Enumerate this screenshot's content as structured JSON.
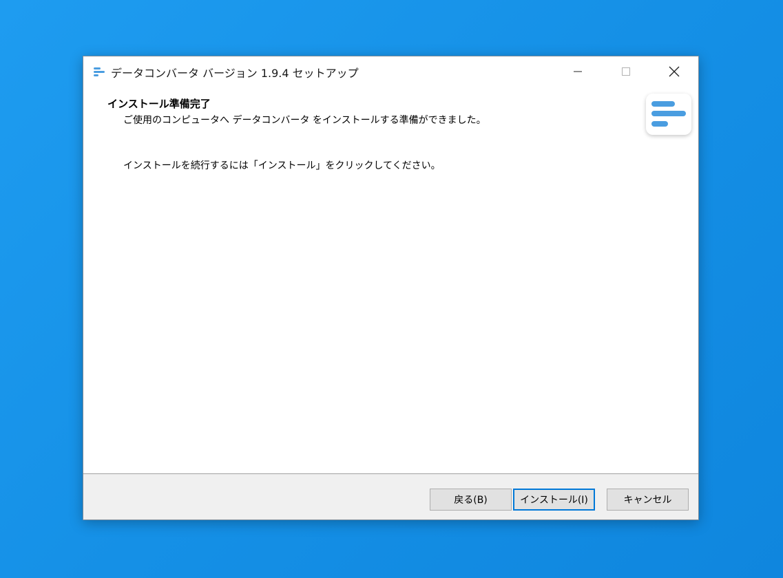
{
  "window": {
    "title": "データコンバータ バージョン 1.9.4 セットアップ"
  },
  "page": {
    "heading": "インストール準備完了",
    "subheading": "ご使用のコンピュータへ データコンバータ をインストールする準備ができました。",
    "instruction": "インストールを続行するには「インストール」をクリックしてください。"
  },
  "buttons": {
    "back": "戻る(B)",
    "install": "インストール(I)",
    "cancel": "キャンセル"
  },
  "colors": {
    "accent": "#0078d7",
    "logo_bars": "#4a9de0",
    "desktop": "#1a96e8"
  },
  "icons": {
    "app": "app-logo-icon",
    "minimize": "minimize-icon",
    "maximize": "maximize-icon",
    "close": "close-icon",
    "header_logo": "app-logo-large-icon"
  }
}
